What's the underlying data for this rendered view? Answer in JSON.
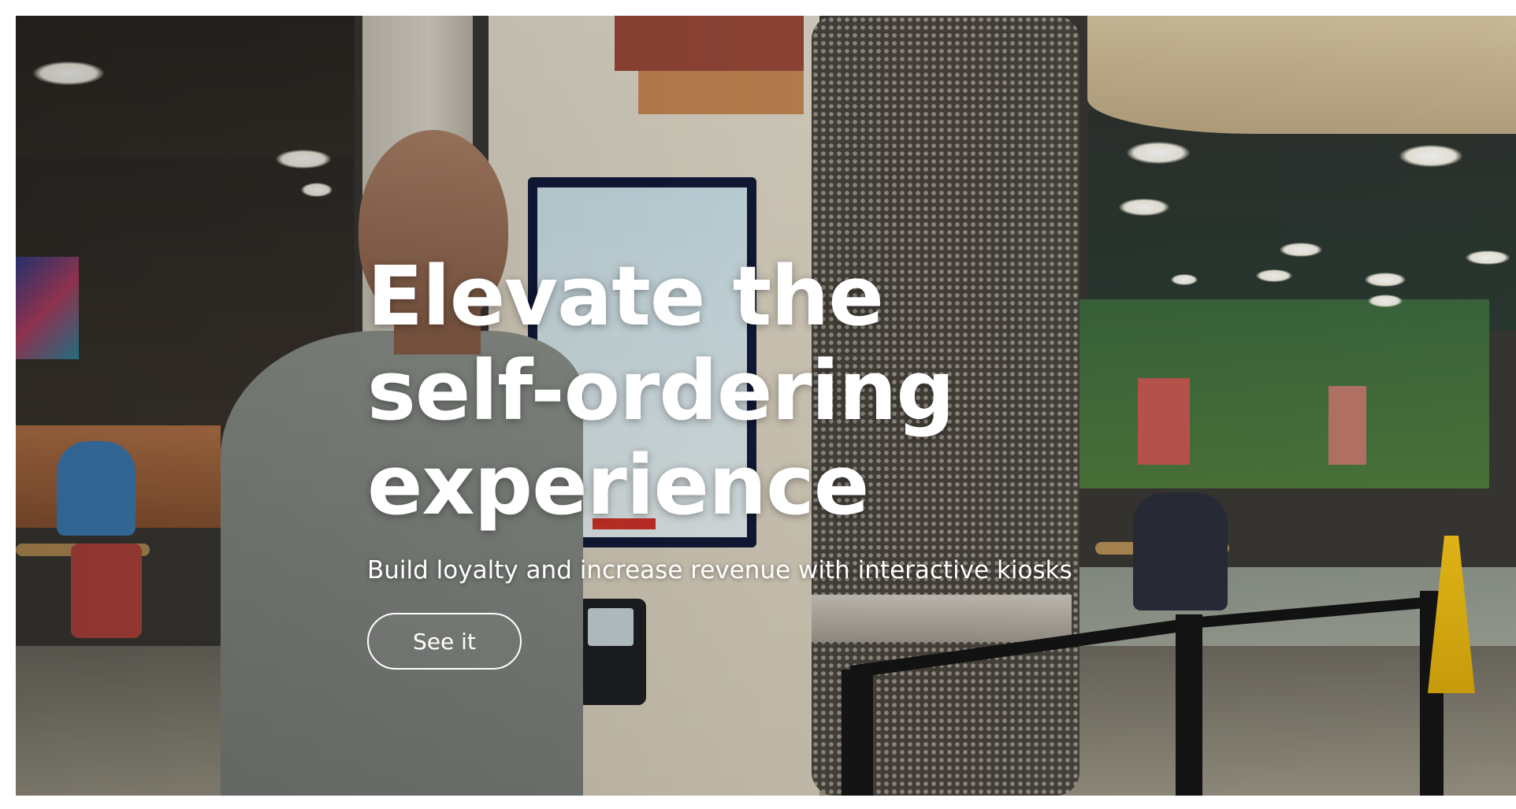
{
  "hero": {
    "headline": "Elevate the self-ordering experience",
    "subtext": "Build loyalty and increase revenue with interactive kiosks",
    "cta_label": "See it"
  },
  "theme": {
    "text_color": "#ffffff",
    "page_background": "#ffffff"
  }
}
